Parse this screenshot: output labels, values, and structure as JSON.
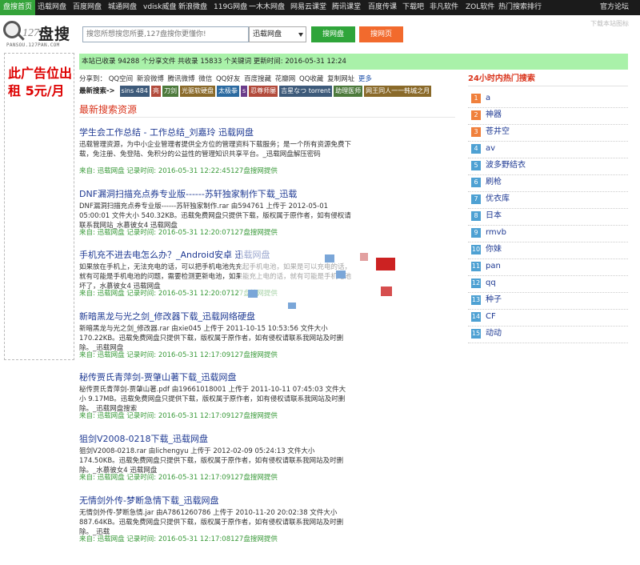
{
  "nav": {
    "items": [
      "盘搜首页",
      "迅载网盘",
      "百度网盘",
      "城通网盘",
      "vdisk威盘",
      "新浪微盘",
      "119G网盘",
      "一木木网盘",
      "网易云课堂",
      "腾讯课堂",
      "百度传课",
      "下载吧",
      "非凡软件",
      "ZOL软件",
      "热门搜索排行"
    ],
    "right": "官方论坛"
  },
  "logo": {
    "num": "127",
    "cn": "盘搜",
    "sub": "PANSOU.127PAN.COM"
  },
  "search": {
    "placeholder": "搜您所想搜您所要,127盘搜你更懂你!",
    "select": "迅载网盘",
    "btn_search": "搜网盘",
    "btn_web": "搜网页",
    "save": "下载本站图标"
  },
  "ad": {
    "text": "此广告位出租 5元/月"
  },
  "stats": "本站已收录 94288 个分享文件 共收录 15833 个关键词 更新时间: 2016-05-31 12:24",
  "share": {
    "label": "分享到：",
    "links": [
      "QQ空间",
      "新浪微博",
      "腾讯微博",
      "微信",
      "QQ好友",
      "百度搜藏",
      "花瓣网",
      "QQ收藏",
      "复制网址"
    ],
    "more": "更多"
  },
  "latest": {
    "label": "最新搜索->",
    "tags": [
      {
        "text": "sins 484",
        "color": "#3d5a7a"
      },
      {
        "text": "亮",
        "color": "#b24b3c"
      },
      {
        "text": "刀剑",
        "color": "#4d7a3c"
      },
      {
        "text": "光驱软硬盘",
        "color": "#8a6a2a"
      },
      {
        "text": "太极拳",
        "color": "#2b6aa0"
      },
      {
        "text": "s",
        "color": "#6b3c8a"
      },
      {
        "text": "忍尊师屡",
        "color": "#b24b3c"
      },
      {
        "text": "吉星なつ torrent",
        "color": "#3d5a7a"
      },
      {
        "text": "助理医师",
        "color": "#4d7a3c"
      },
      {
        "text": "网王同人一一韩城之月",
        "color": "#8a6a2a"
      }
    ]
  },
  "section_title": "最新搜索资源",
  "results": [
    {
      "title": "学生会工作总结 - 工作总结_刘嘉玲 迅载网盘",
      "desc": "迅载管理资源，为中小企业管理者提供全方位的管理资料下载服务；是一个所有资源免费下载，免注册、免登陆、免积分的公益性的管理知识共享平台。_迅载网盘解压密码",
      "meta": "来自: 迅载网盘 记录时间: 2016-05-31 12:22:45127盘搜网提供"
    },
    {
      "title": "DNF漏洞扫描充点券专业版------苏轩独家制作下载_迅载",
      "desc": "DNF漏洞扫描充点券专业版------苏轩独家制作.rar 由594761 上传于 2012-05-01 05:00:01 文件大小 540.32KB。迅载免费网盘只提供下载，版权属于原作者，如有侵权请联系我网站_水慕彼女4 迅载网盘",
      "meta": "来自: 迅载网盘 记录时间: 2016-05-31 12:20:07127盘搜网提供"
    },
    {
      "title": "手机充不进去电怎么办？_Android安卓 迅载网盘",
      "desc": "如果放在手机上，无法充电的话，可以把手机电池先充起手机电池，如果是可以充电的话，就有可能是手机电池的问题，需要检测更新电池，如果能充上电的话，就有可能是手机电池坏了，水慕彼女4 迅载网盘",
      "meta": "来自: 迅载网盘 记录时间: 2016-05-31 12:20:07127盘搜网提供"
    },
    {
      "title": "新暗黑龙与光之剑_修改器下载_迅载网络硬盘",
      "desc": "新暗黑龙与光之剑_修改器.rar 由xie045 上传于 2011-10-15 10:53:56 文件大小 170.22KB。迅载免费网盘只提供下载，版权属于原作者，如有侵权请联系我网站及时删除。_迅载网盘",
      "meta": "来自: 迅载网盘 记录时间: 2016-05-31 12:17:09127盘搜网提供"
    },
    {
      "title": "秘传贾氏青萍剑-贾肇山著下载_迅载网盘",
      "desc": "秘传贾氏青萍剑-贾肇山著.pdf 由19661018001 上传于 2011-10-11 07:45:03 文件大小 9.17MB。迅载免费网盘只提供下载，版权属于原作者，如有侵权请联系我网站及时删除。_迅载网盘搜索",
      "meta": "来自: 迅载网盘 记录时间: 2016-05-31 12:17:09127盘搜网提供"
    },
    {
      "title": "狙剑V2008-0218下载_迅载网盘",
      "desc": "狙剑V2008-0218.rar 由lichengyu 上传于 2012-02-09 05:24:13 文件大小 174.50KB。迅载免费网盘只提供下载，版权属于原作者，如有侵权请联系我网站及时删除。_水慕彼女4 迅载网盘",
      "meta": "来自: 迅载网盘 记录时间: 2016-05-31 12:17:09127盘搜网提供"
    },
    {
      "title": "无情剑外传-梦断急情下载_迅载网盘",
      "desc": "无情剑外传-梦断急情.jar 由A7861260786 上传于 2010-11-20 20:02:38 文件大小 887.64KB。迅载免费网盘只提供下载，版权属于原作者，如有侵权请联系我网站及时删除。_迅载",
      "meta": "来自: 迅载网盘 记录时间: 2016-05-31 12:17:08127盘搜网提供"
    }
  ],
  "hot": {
    "title": "24小时内热门搜索",
    "items": [
      "a",
      "神器",
      "苍井空",
      "av",
      "波多野结衣",
      "刷枪",
      "优衣库",
      "日本",
      "rmvb",
      "你妹",
      "pan",
      "qq",
      "种子",
      "CF",
      "动动"
    ]
  }
}
